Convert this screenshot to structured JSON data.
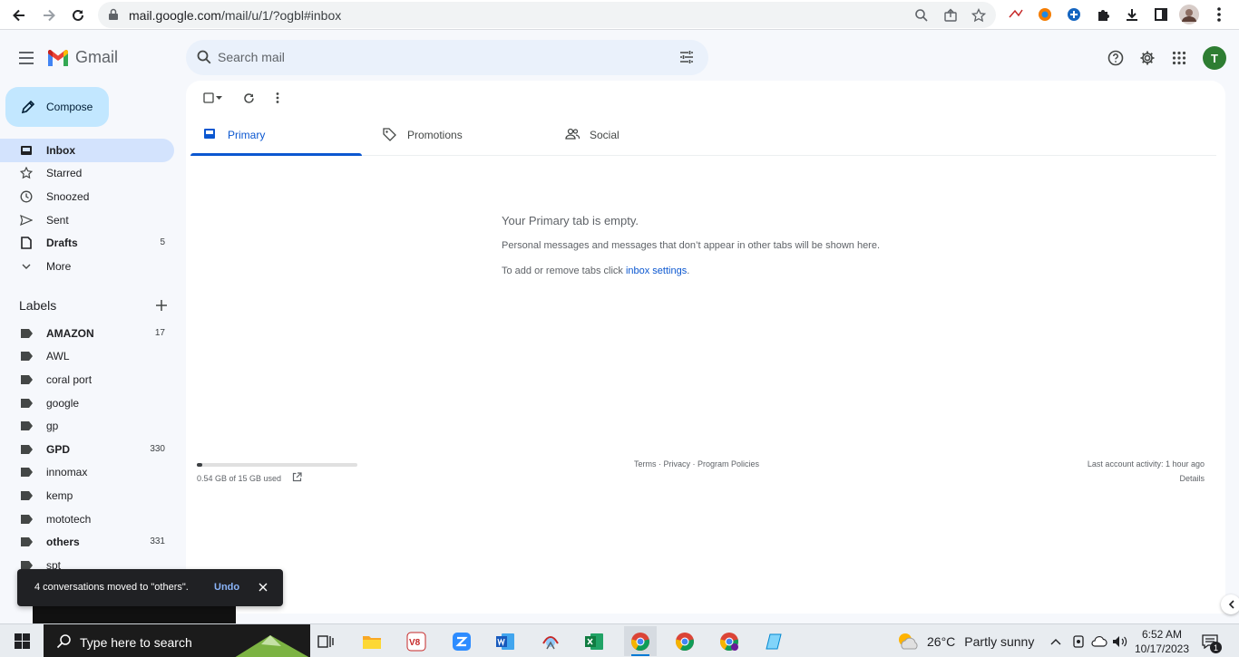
{
  "browser": {
    "url_host": "mail.google.com",
    "url_path": "/mail/u/1/?ogbl#inbox"
  },
  "header": {
    "app_name": "Gmail",
    "search_placeholder": "Search mail",
    "avatar_initial": "T"
  },
  "sidebar": {
    "compose_label": "Compose",
    "items": [
      {
        "label": "Inbox",
        "count": "",
        "icon": "inbox-icon",
        "bold": true,
        "active": true
      },
      {
        "label": "Starred",
        "count": "",
        "icon": "star-icon",
        "bold": false,
        "active": false
      },
      {
        "label": "Snoozed",
        "count": "",
        "icon": "clock-icon",
        "bold": false,
        "active": false
      },
      {
        "label": "Sent",
        "count": "",
        "icon": "send-icon",
        "bold": false,
        "active": false
      },
      {
        "label": "Drafts",
        "count": "5",
        "icon": "draft-icon",
        "bold": true,
        "active": false
      },
      {
        "label": "More",
        "count": "",
        "icon": "chevron-down-icon",
        "bold": false,
        "active": false
      }
    ],
    "labels_header": "Labels",
    "labels": [
      {
        "label": "AMAZON",
        "count": "17",
        "bold": true
      },
      {
        "label": "AWL",
        "count": "",
        "bold": false
      },
      {
        "label": "coral port",
        "count": "",
        "bold": false
      },
      {
        "label": "google",
        "count": "",
        "bold": false
      },
      {
        "label": "gp",
        "count": "",
        "bold": false
      },
      {
        "label": "GPD",
        "count": "330",
        "bold": true
      },
      {
        "label": "innomax",
        "count": "",
        "bold": false
      },
      {
        "label": "kemp",
        "count": "",
        "bold": false
      },
      {
        "label": "mototech",
        "count": "",
        "bold": false
      },
      {
        "label": "others",
        "count": "331",
        "bold": true
      },
      {
        "label": "spt",
        "count": "",
        "bold": false
      }
    ]
  },
  "main": {
    "tabs": [
      {
        "label": "Primary",
        "icon": "inbox-tab-icon"
      },
      {
        "label": "Promotions",
        "icon": "tag-icon"
      },
      {
        "label": "Social",
        "icon": "people-icon"
      }
    ],
    "empty_title": "Your Primary tab is empty.",
    "empty_desc": "Personal messages and messages that don’t appear in other tabs will be shown here.",
    "empty_settings_prefix": "To add or remove tabs click ",
    "empty_settings_link": "inbox settings",
    "empty_settings_suffix": "."
  },
  "footer": {
    "storage_text": "0.54 GB of 15 GB used",
    "storage_fraction": 0.036,
    "terms": "Terms",
    "privacy": "Privacy",
    "program_policies": "Program Policies",
    "separator": " · ",
    "last_activity": "Last account activity: 1 hour ago",
    "details": "Details"
  },
  "snackbar": {
    "message": "4 conversations moved to \"others\".",
    "undo": "Undo"
  },
  "taskbar": {
    "search_placeholder": "Type here to search",
    "weather_temp": "26°C",
    "weather_condition": "Partly sunny",
    "time": "6:52 AM",
    "date": "10/17/2023",
    "notification_count": "1"
  },
  "colors": {
    "accent": "#0b57d0",
    "compose_bg": "#c2e7ff",
    "active_nav_bg": "#d3e3fd",
    "avatar_bg": "#2e7d32"
  }
}
